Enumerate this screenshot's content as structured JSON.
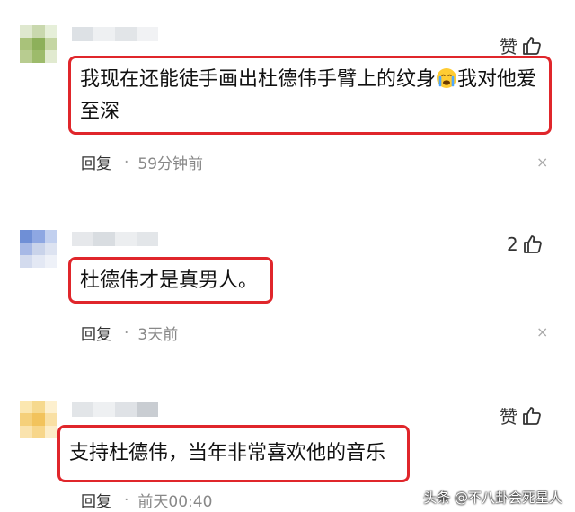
{
  "comments": [
    {
      "like_label": "赞",
      "text_before_emoji": "我现在还能徒手画出杜德伟手臂上的纹身",
      "emoji": "crying-face",
      "text_after_emoji": "我对他爱",
      "text_line2": "至深",
      "reply_label": "回复",
      "separator": "·",
      "time": "59分钟前"
    },
    {
      "like_label": "2",
      "text": "杜德伟才是真男人。",
      "reply_label": "回复",
      "separator": "·",
      "time": "3天前"
    },
    {
      "like_label": "赞",
      "text": "支持杜德伟，当年非常喜欢他的音乐",
      "reply_label": "回复",
      "separator": "·",
      "time": "前天00:40"
    }
  ],
  "close_glyph": "×",
  "watermark": "头条 @不八卦会死星人",
  "colors": {
    "highlight_border": "#e0262b",
    "meta_text": "#888888"
  }
}
